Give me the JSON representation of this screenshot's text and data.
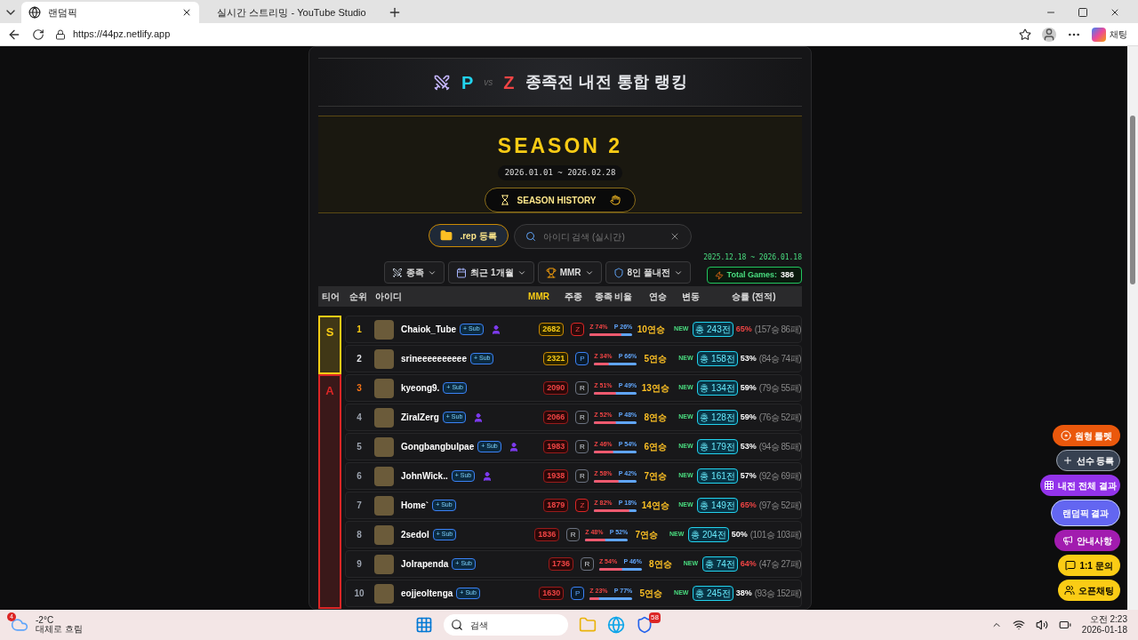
{
  "browser": {
    "tabs": [
      {
        "title": "랜덤픽",
        "selected": true,
        "kind": "globe"
      },
      {
        "title": "실시간 스트리밍 - YouTube Studio",
        "selected": false,
        "kind": "video"
      }
    ],
    "url": "https://44pz.netlify.app",
    "copilot_label": "채팅"
  },
  "header": {
    "left_race": "P",
    "vs": "vs",
    "right_race": "Z",
    "title": "종족전 내전 통합 랭킹"
  },
  "season": {
    "title": "SEASON 2",
    "dates": "2026.01.01 ~ 2026.02.28",
    "history_button": "SEASON HISTORY"
  },
  "toolbar": {
    "upload_button": ".rep 등록",
    "search": {
      "placeholder": "아이디 검색 (실시간)"
    }
  },
  "filters": [
    {
      "label": "종족",
      "kind": "swords"
    },
    {
      "label": "최근 1개월",
      "kind": "calendar"
    },
    {
      "label": "MMR",
      "kind": "trophy"
    },
    {
      "label": "8인 풀내전",
      "kind": "shield"
    }
  ],
  "range": "2025.12.18 ~ 2026.01.18",
  "total_games": {
    "label": "Total Games:",
    "value": "386"
  },
  "table": {
    "columns": [
      "티어",
      "순위",
      "아이디",
      "MMR",
      "주종",
      "종족 비율",
      "연승",
      "변동",
      "승률 (전적)"
    ],
    "tiers": [
      {
        "tier": "S",
        "color": "#facc15",
        "rows": [
          {
            "rank": "1",
            "color": "#facc15",
            "name": "Chaiok_Tube",
            "sub": "+ Sub",
            "streamer": true,
            "mmr": "2682",
            "race": "Z",
            "z_label": "Z 74%",
            "p_label": "P 26%",
            "level": 0.74,
            "streak": "10연승",
            "change": "NEW",
            "total": "총 243전",
            "rate": "65%",
            "hot": true,
            "record": "(157승 86패)"
          },
          {
            "rank": "2",
            "color": "#e5e7eb",
            "name": "srineeeeeeeeee",
            "sub": "+ Sub",
            "streamer": false,
            "mmr": "2321",
            "race": "P",
            "z_label": "Z 34%",
            "p_label": "P 66%",
            "level": 0.34,
            "streak": "5연승",
            "change": "NEW",
            "total": "총 158전",
            "rate": "53%",
            "hot": false,
            "record": "(84승 74패)"
          }
        ]
      },
      {
        "tier": "A",
        "color": "#dc2626",
        "rows": [
          {
            "rank": "3",
            "color": "#f97316",
            "name": "kyeong9.",
            "sub": "+ Sub",
            "streamer": false,
            "mmr": "2090",
            "race": "R",
            "z_label": "Z 51%",
            "p_label": "P 49%",
            "level": 0.51,
            "streak": "13연승",
            "change": "NEW",
            "total": "총 134전",
            "rate": "59%",
            "hot": false,
            "record": "(79승 55패)"
          },
          {
            "rank": "4",
            "color": "#9ca3af",
            "name": "ZiralZerg",
            "sub": "+ Sub",
            "streamer": true,
            "mmr": "2066",
            "race": "R",
            "z_label": "Z 52%",
            "p_label": "P 48%",
            "level": 0.52,
            "streak": "8연승",
            "change": "NEW",
            "total": "총 128전",
            "rate": "59%",
            "hot": false,
            "record": "(76승 52패)"
          },
          {
            "rank": "5",
            "color": "#9ca3af",
            "name": "Gongbangbulpae",
            "sub": "+ Sub",
            "streamer": true,
            "mmr": "1983",
            "race": "R",
            "z_label": "Z 46%",
            "p_label": "P 54%",
            "level": 0.46,
            "streak": "6연승",
            "change": "NEW",
            "total": "총 179전",
            "rate": "53%",
            "hot": false,
            "record": "(94승 85패)"
          },
          {
            "rank": "6",
            "color": "#9ca3af",
            "name": "JohnWick..",
            "sub": "+ Sub",
            "streamer": true,
            "mmr": "1938",
            "race": "R",
            "z_label": "Z 58%",
            "p_label": "P 42%",
            "level": 0.58,
            "streak": "7연승",
            "change": "NEW",
            "total": "총 161전",
            "rate": "57%",
            "hot": false,
            "record": "(92승 69패)"
          },
          {
            "rank": "7",
            "color": "#9ca3af",
            "name": "Home`",
            "sub": "+ Sub",
            "streamer": false,
            "mmr": "1879",
            "race": "Z",
            "z_label": "Z 82%",
            "p_label": "P 18%",
            "level": 0.82,
            "streak": "14연승",
            "change": "NEW",
            "total": "총 149전",
            "rate": "65%",
            "hot": true,
            "record": "(97승 52패)"
          },
          {
            "rank": "8",
            "color": "#9ca3af",
            "name": "2sedoI",
            "sub": "+ Sub",
            "streamer": false,
            "mmr": "1836",
            "race": "R",
            "z_label": "Z 48%",
            "p_label": "P 52%",
            "level": 0.48,
            "streak": "7연승",
            "change": "NEW",
            "total": "총 204전",
            "rate": "50%",
            "hot": false,
            "record": "(101승 103패)"
          },
          {
            "rank": "9",
            "color": "#9ca3af",
            "name": "Jolrapenda",
            "sub": "+ Sub",
            "streamer": false,
            "mmr": "1736",
            "race": "R",
            "z_label": "Z 54%",
            "p_label": "P 46%",
            "level": 0.54,
            "streak": "8연승",
            "change": "NEW",
            "total": "총 74전",
            "rate": "64%",
            "hot": true,
            "record": "(47승 27패)"
          },
          {
            "rank": "10",
            "color": "#9ca3af",
            "name": "eojjeoltenga",
            "sub": "+ Sub",
            "streamer": false,
            "mmr": "1630",
            "race": "P",
            "z_label": "Z 23%",
            "p_label": "P 77%",
            "level": 0.23,
            "streak": "5연승",
            "change": "NEW",
            "total": "총 245전",
            "rate": "38%",
            "hot": false,
            "record": "(93승 152패)"
          }
        ]
      }
    ]
  },
  "float_buttons": [
    {
      "label": "원형 룰렛",
      "kind": "roulette"
    },
    {
      "label": "선수 등록",
      "kind": "register"
    },
    {
      "label": "내전 전체 결과",
      "kind": "results"
    },
    {
      "label": "랜덤픽 결과",
      "kind": "random"
    },
    {
      "label": "안내사항",
      "kind": "notice"
    },
    {
      "label": "1:1 문의",
      "kind": "inquiry"
    },
    {
      "label": "오픈채팅",
      "kind": "chat"
    }
  ],
  "taskbar": {
    "weather_badge": "4",
    "temperature": "-2°C",
    "weather": "대체로 흐림",
    "search": "검색",
    "app_badge": "58",
    "time": "오전 2:23",
    "date": "2026-01-18"
  }
}
